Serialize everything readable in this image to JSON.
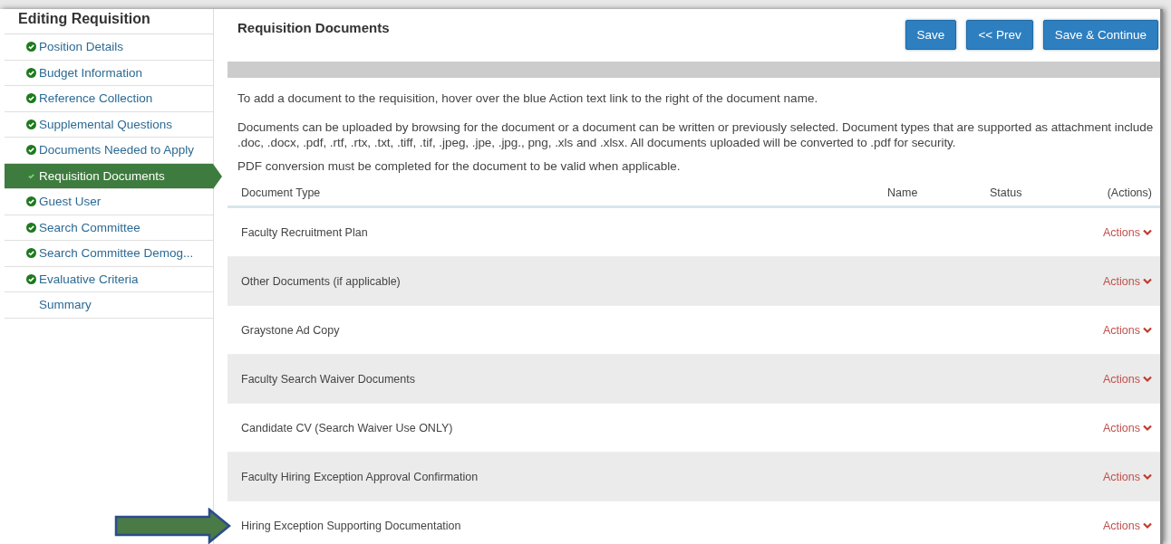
{
  "sidebar": {
    "title": "Editing Requisition",
    "items": [
      {
        "label": "Position Details",
        "complete": true,
        "selected": false
      },
      {
        "label": "Budget Information",
        "complete": true,
        "selected": false
      },
      {
        "label": "Reference Collection",
        "complete": true,
        "selected": false
      },
      {
        "label": "Supplemental Questions",
        "complete": true,
        "selected": false
      },
      {
        "label": "Documents Needed to Apply",
        "complete": true,
        "selected": false
      },
      {
        "label": "Requisition Documents",
        "complete": true,
        "selected": true
      },
      {
        "label": "Guest User",
        "complete": true,
        "selected": false
      },
      {
        "label": "Search Committee",
        "complete": true,
        "selected": false
      },
      {
        "label": "Search Committee Demog...",
        "complete": true,
        "selected": false
      },
      {
        "label": "Evaluative Criteria",
        "complete": true,
        "selected": false
      },
      {
        "label": "Summary",
        "complete": false,
        "selected": false
      }
    ]
  },
  "page_title": "Requisition Documents",
  "buttons": [
    "Save",
    "<< Prev",
    "Save & Continue"
  ],
  "instructions": [
    "To add a document to the requisition, hover over the blue Action text link to the right of the document name.",
    "Documents can be uploaded by browsing for the document or a document can be written or previously selected. Document types that are supported as attachment include .doc, .docx, .pdf, .rtf, .rtx, .txt, .tiff, .tif, .jpeg, .jpe, .jpg., png, .xls and .xlsx. All documents uploaded will be converted to .pdf for security.",
    "PDF conversion must be completed for the document to be valid when applicable."
  ],
  "table": {
    "columns": [
      "Document Type",
      "Name",
      "Status",
      "(Actions)"
    ],
    "rows": [
      {
        "document_type": "Faculty Recruitment Plan",
        "action": "Actions"
      },
      {
        "document_type": "Other Documents (if applicable)",
        "action": "Actions"
      },
      {
        "document_type": "Graystone Ad Copy",
        "action": "Actions"
      },
      {
        "document_type": "Faculty Search Waiver Documents",
        "action": "Actions"
      },
      {
        "document_type": "Candidate CV (Search Waiver Use ONLY)",
        "action": "Actions"
      },
      {
        "document_type": "Faculty Hiring Exception Approval Confirmation",
        "action": "Actions"
      },
      {
        "document_type": "Hiring Exception Supporting Documentation",
        "action": "Actions"
      }
    ]
  }
}
